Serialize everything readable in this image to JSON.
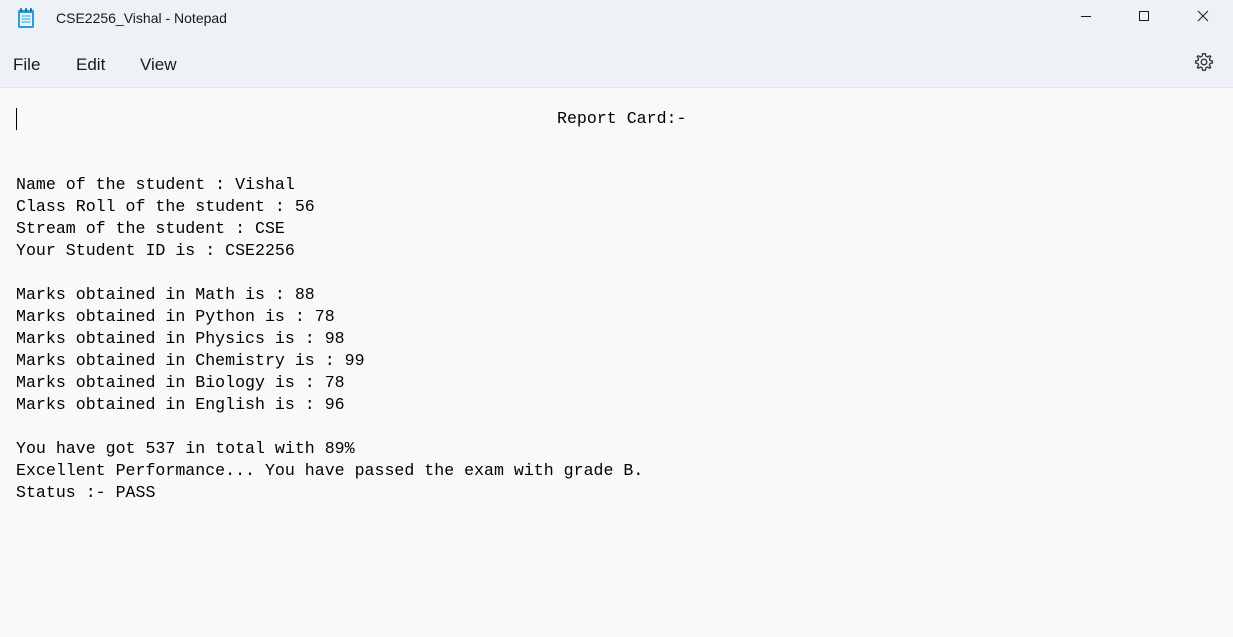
{
  "window": {
    "title": "CSE2256_Vishal - Notepad",
    "controls": {
      "minimize": "minimize",
      "maximize": "maximize",
      "close": "close"
    }
  },
  "menu": {
    "file": "File",
    "edit": "Edit",
    "view": "View"
  },
  "document": {
    "title_line": "Report Card:-",
    "lines": [
      "Name of the student : Vishal",
      "Class Roll of the student : 56",
      "Stream of the student : CSE",
      "Your Student ID is : CSE2256",
      "",
      "Marks obtained in Math is : 88",
      "Marks obtained in Python is : 78",
      "Marks obtained in Physics is : 98",
      "Marks obtained in Chemistry is : 99",
      "Marks obtained in Biology is : 78",
      "Marks obtained in English is : 96",
      "",
      "You have got 537 in total with 89%",
      "Excellent Performance... You have passed the exam with grade B.",
      "Status :- PASS"
    ]
  },
  "icons": {
    "app": "notepad-icon",
    "settings": "gear-icon"
  },
  "colors": {
    "chrome_bg": "#eef1f5",
    "editor_bg": "#f9f9f9",
    "app_icon_accent": "#2a9fd6"
  }
}
